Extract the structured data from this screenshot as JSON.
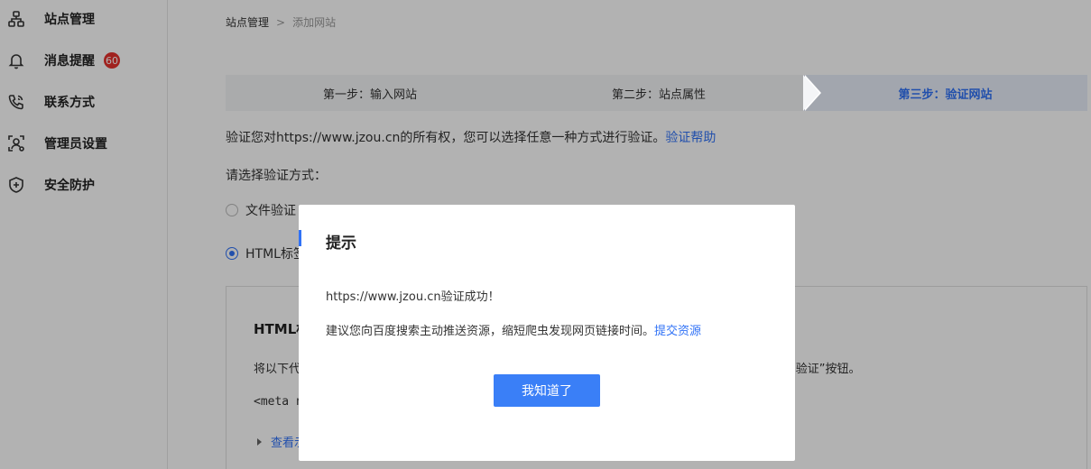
{
  "sidebar": {
    "items": [
      {
        "label": "站点管理",
        "icon": "sitemap-icon"
      },
      {
        "label": "消息提醒",
        "icon": "bell-icon",
        "badge": "60"
      },
      {
        "label": "联系方式",
        "icon": "phone-icon"
      },
      {
        "label": "管理员设置",
        "icon": "admin-user-icon"
      },
      {
        "label": "安全防护",
        "icon": "shield-plus-icon"
      }
    ]
  },
  "breadcrumb": {
    "root": "站点管理",
    "separator": ">",
    "current": "添加网站"
  },
  "steps": [
    {
      "label": "第一步：输入网站"
    },
    {
      "label": "第二步：站点属性"
    },
    {
      "label": "第三步：验证网站",
      "active": true
    }
  ],
  "verify": {
    "description": "验证您对https://www.jzou.cn的所有权，您可以选择任意一种方式进行验证。",
    "help_link": "验证帮助",
    "choose_label": "请选择验证方式：",
    "options": [
      {
        "label": "文件验证",
        "checked": false
      },
      {
        "label": "HTML标签",
        "checked": true
      }
    ]
  },
  "panel": {
    "title": "HTML标",
    "text_left": "将以下代",
    "text_right": "击“验证”按钮。",
    "code": "<meta n",
    "more": "查看示"
  },
  "modal": {
    "title": "提示",
    "line1": "https://www.jzou.cn验证成功！",
    "line2": "建议您向百度搜索主动推送资源，缩短爬虫发现网页链接时间。",
    "line2_link": "提交资源",
    "button": "我知道了"
  },
  "colors": {
    "accent": "#3072f6",
    "badge": "#e5322d",
    "overlay": "rgba(0,0,0,0.30)"
  }
}
